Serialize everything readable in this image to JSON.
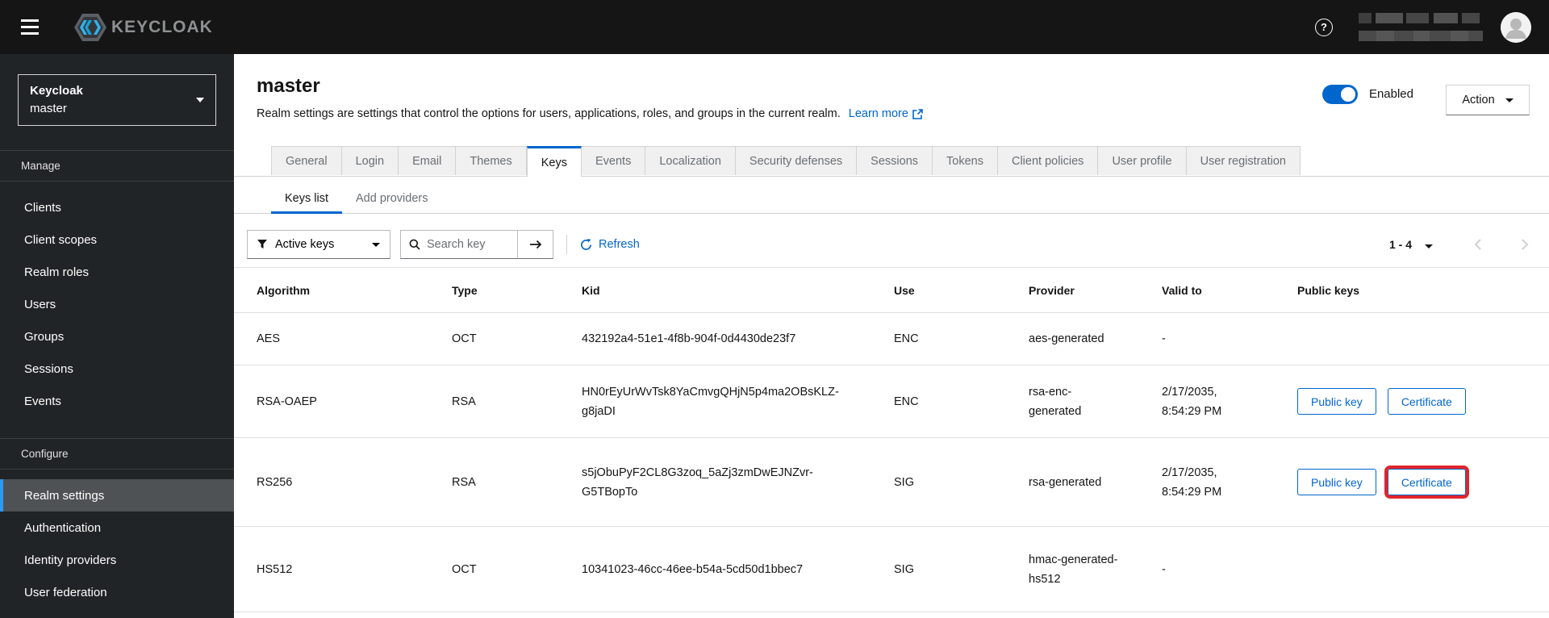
{
  "masthead": {
    "brand": "KEYCLOAK"
  },
  "sidebar": {
    "realm_selector": {
      "name": "Keycloak",
      "realm": "master"
    },
    "sections": [
      {
        "label": "Manage",
        "items": [
          "Clients",
          "Client scopes",
          "Realm roles",
          "Users",
          "Groups",
          "Sessions",
          "Events"
        ]
      },
      {
        "label": "Configure",
        "items": [
          "Realm settings",
          "Authentication",
          "Identity providers",
          "User federation"
        ],
        "selected_item": "Realm settings"
      }
    ]
  },
  "page": {
    "title": "master",
    "description": "Realm settings are settings that control the options for users, applications, roles, and groups in the current realm.",
    "learn_more_label": "Learn more",
    "enabled_label": "Enabled",
    "action_label": "Action"
  },
  "tabs": {
    "active": "Keys",
    "items": [
      "General",
      "Login",
      "Email",
      "Themes",
      "Keys",
      "Events",
      "Localization",
      "Security defenses",
      "Sessions",
      "Tokens",
      "Client policies",
      "User profile",
      "User registration"
    ]
  },
  "subtabs": {
    "active": "Keys list",
    "items": [
      "Keys list",
      "Add providers"
    ]
  },
  "toolbar": {
    "filter_label": "Active keys",
    "search_placeholder": "Search key",
    "refresh_label": "Refresh",
    "pagination_range": "1 - 4"
  },
  "table": {
    "columns": [
      "Algorithm",
      "Type",
      "Kid",
      "Use",
      "Provider",
      "Valid to",
      "Public keys"
    ],
    "rows": [
      {
        "algorithm": "AES",
        "type": "OCT",
        "kid": "432192a4-51e1-4f8b-904f-0d4430de23f7",
        "use": "ENC",
        "provider": "aes-generated",
        "valid_to": "-",
        "buttons": []
      },
      {
        "algorithm": "RSA-OAEP",
        "type": "RSA",
        "kid": "HN0rEyUrWvTsk8YaCmvgQHjN5p4ma2OBsKLZ-g8jaDI",
        "use": "ENC",
        "provider": "rsa-enc-generated",
        "valid_to": "2/17/2035, 8:54:29 PM",
        "buttons": [
          "Public key",
          "Certificate"
        ]
      },
      {
        "algorithm": "RS256",
        "type": "RSA",
        "kid": "s5jObuPyF2CL8G3zoq_5aZj3zmDwEJNZvr-G5TBopTo",
        "use": "SIG",
        "provider": "rsa-generated",
        "valid_to": "2/17/2035, 8:54:29 PM",
        "buttons": [
          "Public key",
          "Certificate"
        ],
        "highlighted_button": "Certificate"
      },
      {
        "algorithm": "HS512",
        "type": "OCT",
        "kid": "10341023-46cc-46ee-b54a-5cd50d1bbec7",
        "use": "SIG",
        "provider": "hmac-generated-hs512",
        "valid_to": "-",
        "buttons": []
      }
    ]
  },
  "colors": {
    "accent_blue": "#0066cc",
    "highlight_red": "#e2242b",
    "masthead_bg": "#151515",
    "sidebar_bg": "#212427",
    "nav_selected_bg": "#4f5255",
    "nav_indicator": "#2b9af3",
    "tab_inactive_bg": "#f0f0f0"
  }
}
